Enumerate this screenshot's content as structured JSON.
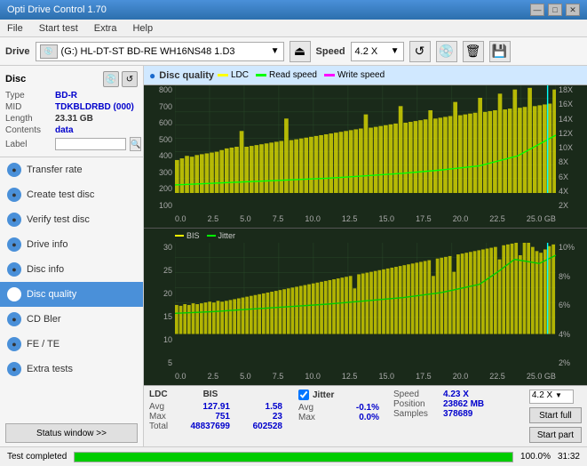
{
  "app": {
    "title": "Opti Drive Control 1.70",
    "titlebar_controls": [
      "—",
      "□",
      "✕"
    ]
  },
  "menubar": {
    "items": [
      "File",
      "Start test",
      "Extra",
      "Help"
    ]
  },
  "drivebar": {
    "drive_label": "Drive",
    "drive_name": "(G:)  HL-DT-ST BD-RE  WH16NS48 1.D3",
    "speed_label": "Speed",
    "speed_value": "4.2 X"
  },
  "disc": {
    "title": "Disc",
    "type_label": "Type",
    "type_value": "BD-R",
    "mid_label": "MID",
    "mid_value": "TDKBLDRBD (000)",
    "length_label": "Length",
    "length_value": "23.31 GB",
    "contents_label": "Contents",
    "contents_value": "data",
    "label_label": "Label",
    "label_value": ""
  },
  "nav": {
    "items": [
      {
        "label": "Transfer rate",
        "active": false,
        "icon": "●"
      },
      {
        "label": "Create test disc",
        "active": false,
        "icon": "●"
      },
      {
        "label": "Verify test disc",
        "active": false,
        "icon": "●"
      },
      {
        "label": "Drive info",
        "active": false,
        "icon": "●"
      },
      {
        "label": "Disc info",
        "active": false,
        "icon": "●"
      },
      {
        "label": "Disc quality",
        "active": true,
        "icon": "●"
      },
      {
        "label": "CD Bler",
        "active": false,
        "icon": "●"
      },
      {
        "label": "FE / TE",
        "active": false,
        "icon": "●"
      },
      {
        "label": "Extra tests",
        "active": false,
        "icon": "●"
      }
    ]
  },
  "status": {
    "button_label": "Status window >>",
    "progress": 100,
    "progress_text": "100.0%",
    "time": "31:32"
  },
  "disc_quality": {
    "title": "Disc quality",
    "legend": [
      {
        "label": "LDC",
        "color": "#ffff00"
      },
      {
        "label": "Read speed",
        "color": "#00ff00"
      },
      {
        "label": "Write speed",
        "color": "#ff00ff"
      }
    ],
    "legend2": [
      {
        "label": "BIS",
        "color": "#ffff00"
      },
      {
        "label": "Jitter",
        "color": "#00ff00"
      }
    ],
    "top_chart": {
      "y_left": [
        "800",
        "700",
        "600",
        "500",
        "400",
        "300",
        "200",
        "100"
      ],
      "y_right": [
        "18X",
        "16X",
        "14X",
        "12X",
        "10X",
        "8X",
        "6X",
        "4X",
        "2X"
      ],
      "x": [
        "0.0",
        "2.5",
        "5.0",
        "7.5",
        "10.0",
        "12.5",
        "15.0",
        "17.5",
        "20.0",
        "22.5",
        "25.0 GB"
      ]
    },
    "bottom_chart": {
      "y_left": [
        "30",
        "25",
        "20",
        "15",
        "10",
        "5"
      ],
      "y_right": [
        "10%",
        "8%",
        "6%",
        "4%",
        "2%"
      ],
      "x": [
        "0.0",
        "2.5",
        "5.0",
        "7.5",
        "10.0",
        "12.5",
        "15.0",
        "17.5",
        "20.0",
        "22.5",
        "25.0 GB"
      ]
    },
    "stats": {
      "headers": [
        "LDC",
        "BIS"
      ],
      "avg_label": "Avg",
      "avg_ldc": "127.91",
      "avg_bis": "1.58",
      "max_label": "Max",
      "max_ldc": "751",
      "max_bis": "23",
      "total_label": "Total",
      "total_ldc": "48837699",
      "total_bis": "602528",
      "jitter_header": "Jitter",
      "jitter_avg": "-0.1%",
      "jitter_max": "0.0%",
      "jitter_samples": "",
      "speed_label": "Speed",
      "speed_value": "4.23 X",
      "position_label": "Position",
      "position_value": "23862 MB",
      "samples_label": "Samples",
      "samples_value": "378689",
      "speed_dropdown": "4.2 X",
      "btn1": "Start full",
      "btn2": "Start part"
    }
  }
}
